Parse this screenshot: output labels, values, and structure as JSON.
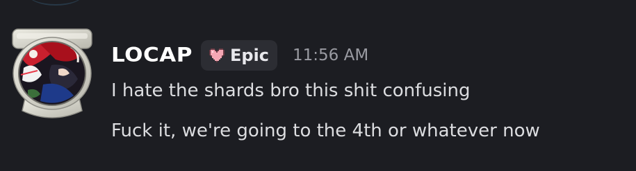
{
  "message": {
    "username": "LOCAP",
    "tag": {
      "label": "Epic",
      "icon": "pixel-heart-icon",
      "icon_color": "#f4a7b4"
    },
    "timestamp": "11:56 AM",
    "lines": [
      "I hate the shards bro this shit confusing",
      "Fuck it, we're going to the 4th or whatever now"
    ],
    "avatar": "toilet-avatar-with-anime-artwork"
  },
  "colors": {
    "background": "#1c1d22",
    "username": "#ffffff",
    "tag_background": "#2c2d33",
    "message_text": "#dcdde0",
    "timestamp": "#9a9ba2"
  }
}
